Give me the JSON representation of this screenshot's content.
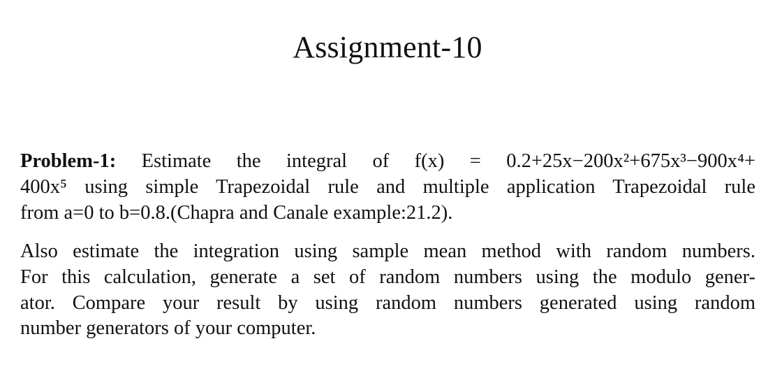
{
  "title": "Assignment-10",
  "problem": {
    "label": "Problem-1:",
    "lines": [
      " Estimate the integral of f(x) = 0.2+25x−200x²+675x³−900x⁴+",
      "400x⁵ using simple Trapezoidal rule and multiple application Trapezoidal rule",
      "from a=0 to b=0.8.(Chapra and Canale example:21.2)."
    ]
  },
  "paragraph2": {
    "lines": [
      "Also estimate the integration using sample mean method with random numbers.",
      "For this calculation, generate a set of random numbers using the modulo gener-",
      "ator. Compare your result by using random numbers generated using random",
      "number generators of your computer."
    ]
  }
}
